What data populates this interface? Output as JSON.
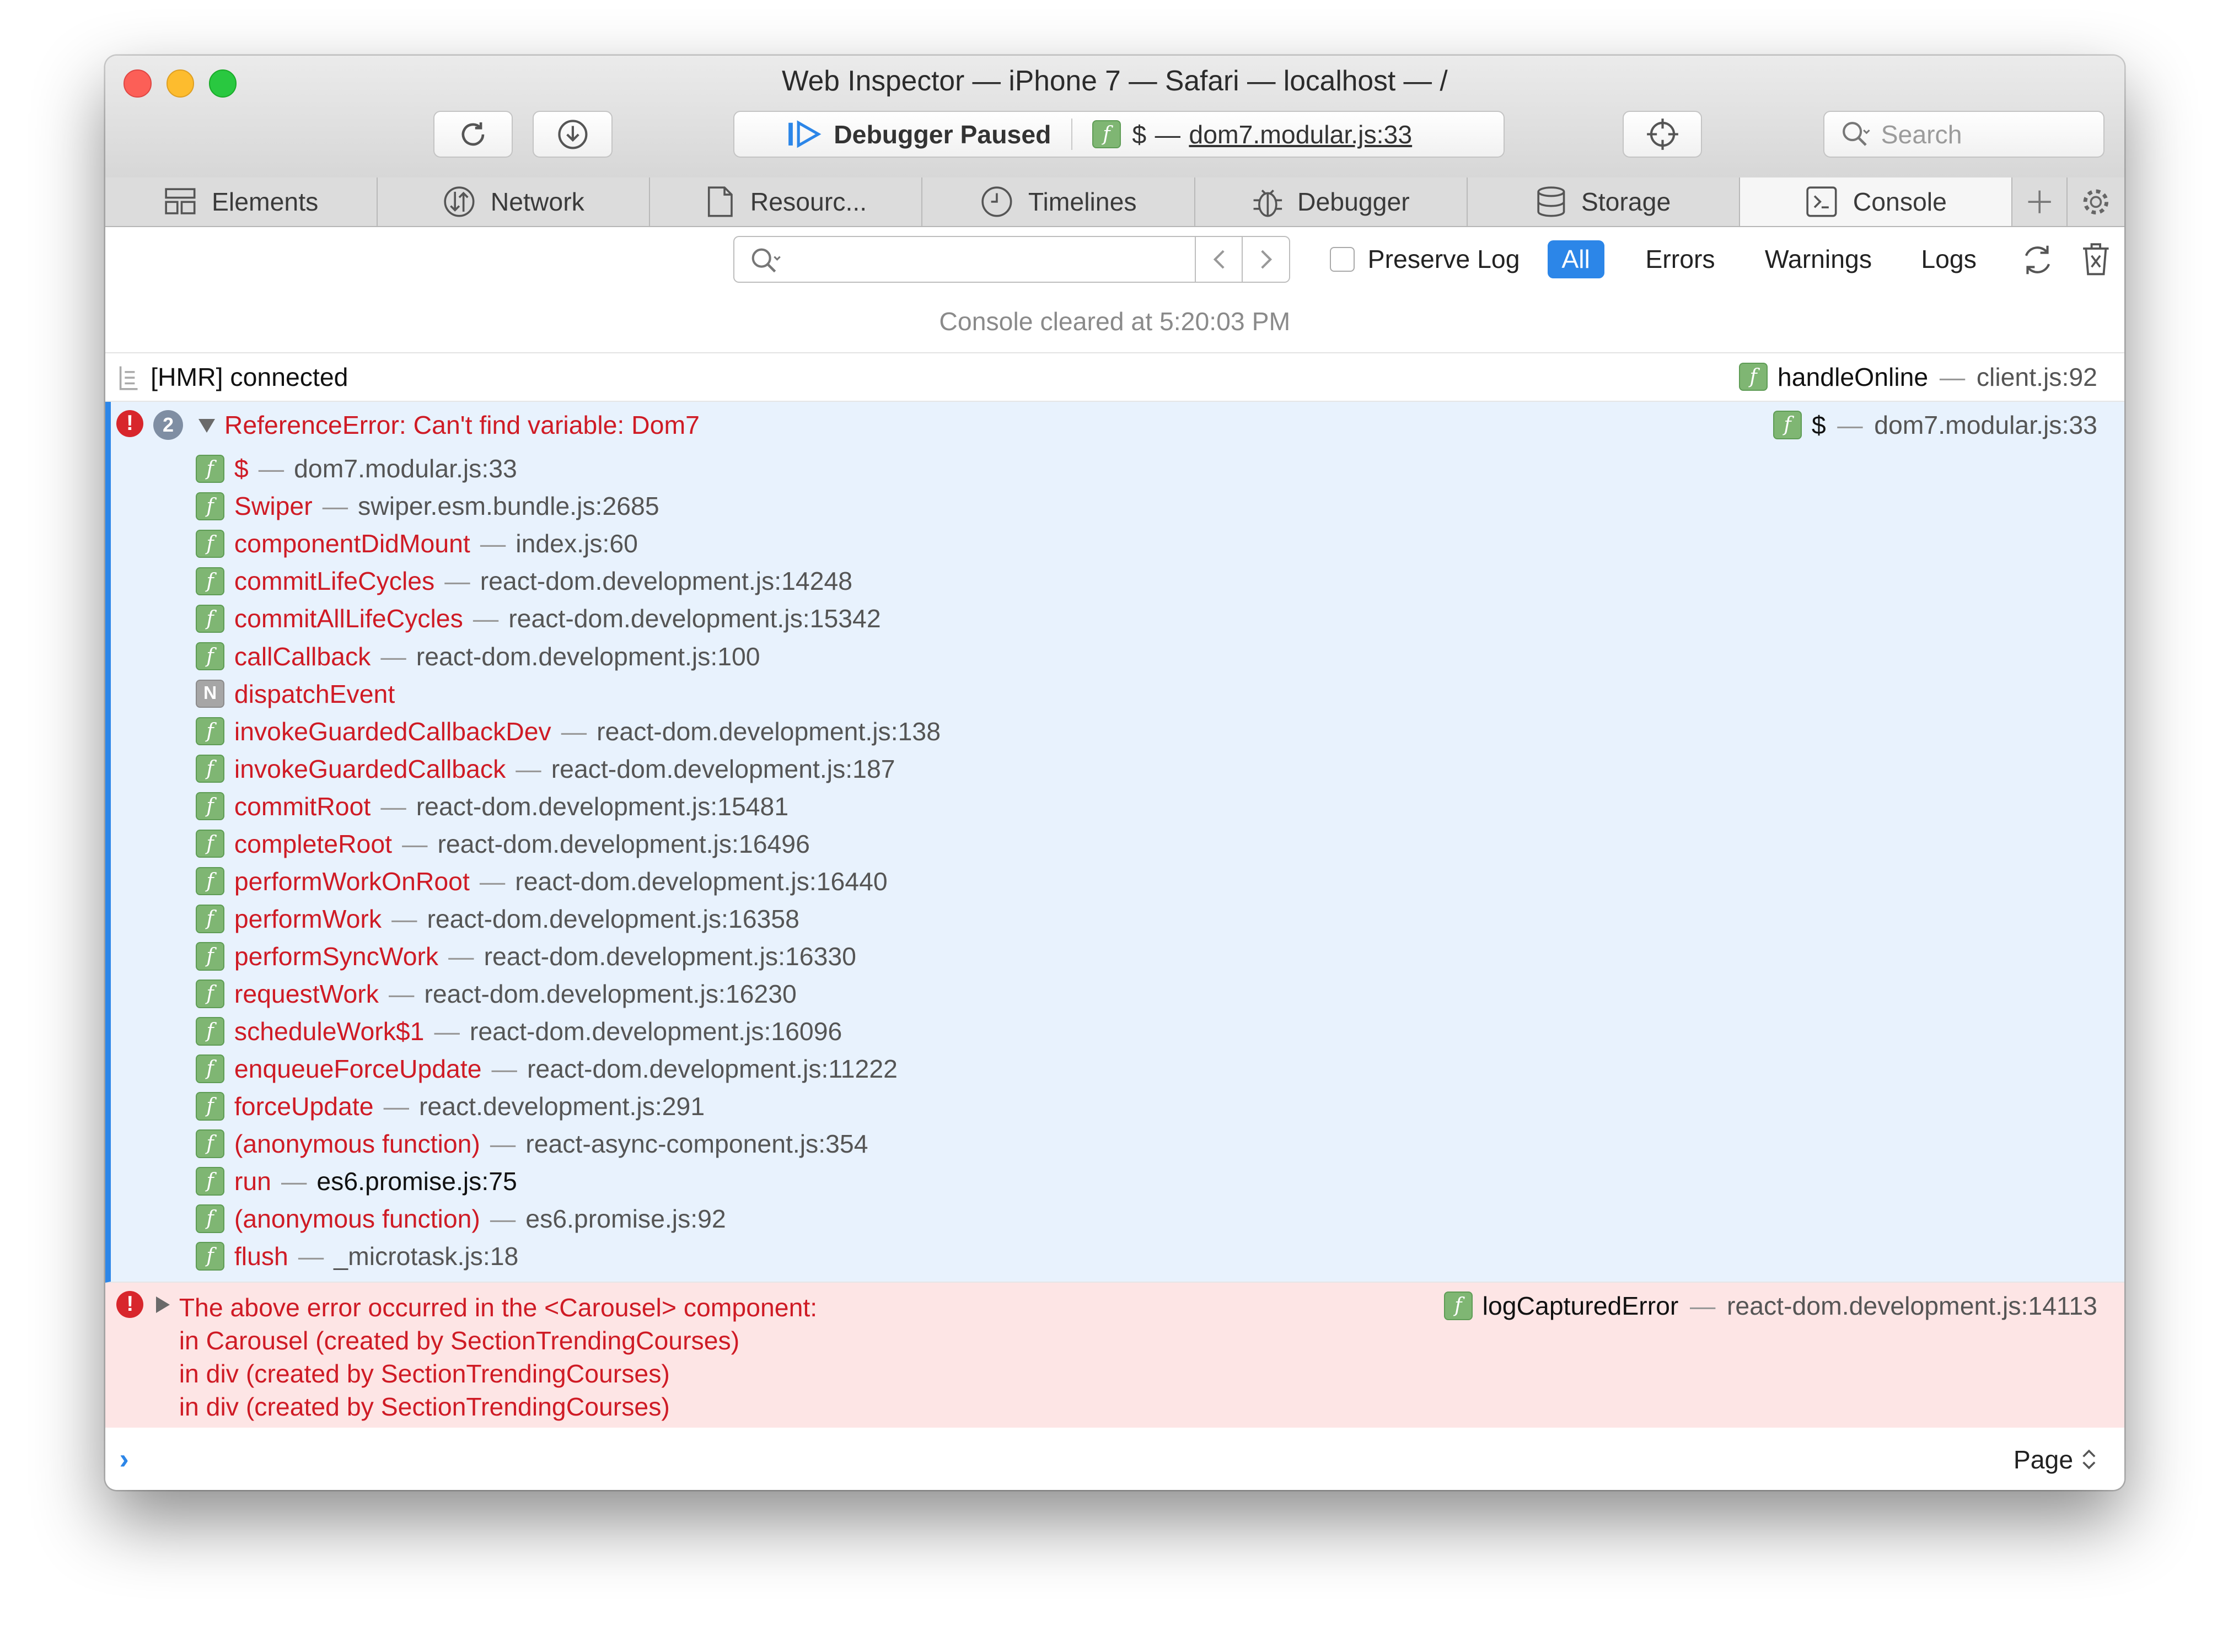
{
  "window": {
    "title": "Web Inspector — iPhone 7 — Safari — localhost — /"
  },
  "toolbar": {
    "status_label": "Debugger Paused",
    "status_frame_fn": "$",
    "status_frame_sep": "—",
    "status_frame_loc": "dom7.modular.js:33",
    "search_placeholder": "Search"
  },
  "tabs": [
    {
      "label": "Elements",
      "icon": "elements-icon"
    },
    {
      "label": "Network",
      "icon": "network-icon"
    },
    {
      "label": "Resourc...",
      "icon": "resources-icon"
    },
    {
      "label": "Timelines",
      "icon": "timelines-icon"
    },
    {
      "label": "Debugger",
      "icon": "debugger-icon"
    },
    {
      "label": "Storage",
      "icon": "storage-icon"
    },
    {
      "label": "Console",
      "icon": "console-icon"
    }
  ],
  "filter": {
    "preserve_log": "Preserve Log",
    "all": "All",
    "errors": "Errors",
    "warnings": "Warnings",
    "logs": "Logs"
  },
  "console": {
    "cleared": "Console cleared at 5:20:03 PM",
    "log": {
      "text": "[HMR] connected",
      "fn": "handleOnline",
      "loc": "client.js:92"
    },
    "error": {
      "count": "2",
      "message": "ReferenceError: Can't find variable: Dom7",
      "fn": "$",
      "loc": "dom7.modular.js:33",
      "frames": [
        {
          "type": "f",
          "fn": "$",
          "loc": "dom7.modular.js:33"
        },
        {
          "type": "f",
          "fn": "Swiper",
          "loc": "swiper.esm.bundle.js:2685"
        },
        {
          "type": "f",
          "fn": "componentDidMount",
          "loc": "index.js:60"
        },
        {
          "type": "f",
          "fn": "commitLifeCycles",
          "loc": "react-dom.development.js:14248"
        },
        {
          "type": "f",
          "fn": "commitAllLifeCycles",
          "loc": "react-dom.development.js:15342"
        },
        {
          "type": "f",
          "fn": "callCallback",
          "loc": "react-dom.development.js:100"
        },
        {
          "type": "N",
          "fn": "dispatchEvent",
          "loc": ""
        },
        {
          "type": "f",
          "fn": "invokeGuardedCallbackDev",
          "loc": "react-dom.development.js:138"
        },
        {
          "type": "f",
          "fn": "invokeGuardedCallback",
          "loc": "react-dom.development.js:187"
        },
        {
          "type": "f",
          "fn": "commitRoot",
          "loc": "react-dom.development.js:15481"
        },
        {
          "type": "f",
          "fn": "completeRoot",
          "loc": "react-dom.development.js:16496"
        },
        {
          "type": "f",
          "fn": "performWorkOnRoot",
          "loc": "react-dom.development.js:16440"
        },
        {
          "type": "f",
          "fn": "performWork",
          "loc": "react-dom.development.js:16358"
        },
        {
          "type": "f",
          "fn": "performSyncWork",
          "loc": "react-dom.development.js:16330"
        },
        {
          "type": "f",
          "fn": "requestWork",
          "loc": "react-dom.development.js:16230"
        },
        {
          "type": "f",
          "fn": "scheduleWork$1",
          "loc": "react-dom.development.js:16096"
        },
        {
          "type": "f",
          "fn": "enqueueForceUpdate",
          "loc": "react-dom.development.js:11222"
        },
        {
          "type": "f",
          "fn": "forceUpdate",
          "loc": "react.development.js:291"
        },
        {
          "type": "f",
          "fn": "(anonymous function)",
          "loc": "react-async-component.js:354"
        },
        {
          "type": "f",
          "fn": "run",
          "loc": "es6.promise.js:75"
        },
        {
          "type": "f",
          "fn": "(anonymous function)",
          "loc": "es6.promise.js:92"
        },
        {
          "type": "f",
          "fn": "flush",
          "loc": "_microtask.js:18"
        }
      ]
    },
    "error2": {
      "message": "The above error occurred in the <Carousel> component:",
      "lines": [
        "in Carousel (created by SectionTrendingCourses)",
        "in div (created by SectionTrendingCourses)",
        "in div (created by SectionTrendingCourses)"
      ],
      "fn": "logCapturedError",
      "loc": "react-dom.development.js:14113"
    }
  },
  "prompt": {
    "context": "Page"
  },
  "colors": {
    "accent": "#2c86e8",
    "error": "#cf1b25",
    "error_bg": "#fde5e5",
    "selected_bg": "#e8f2fd"
  }
}
